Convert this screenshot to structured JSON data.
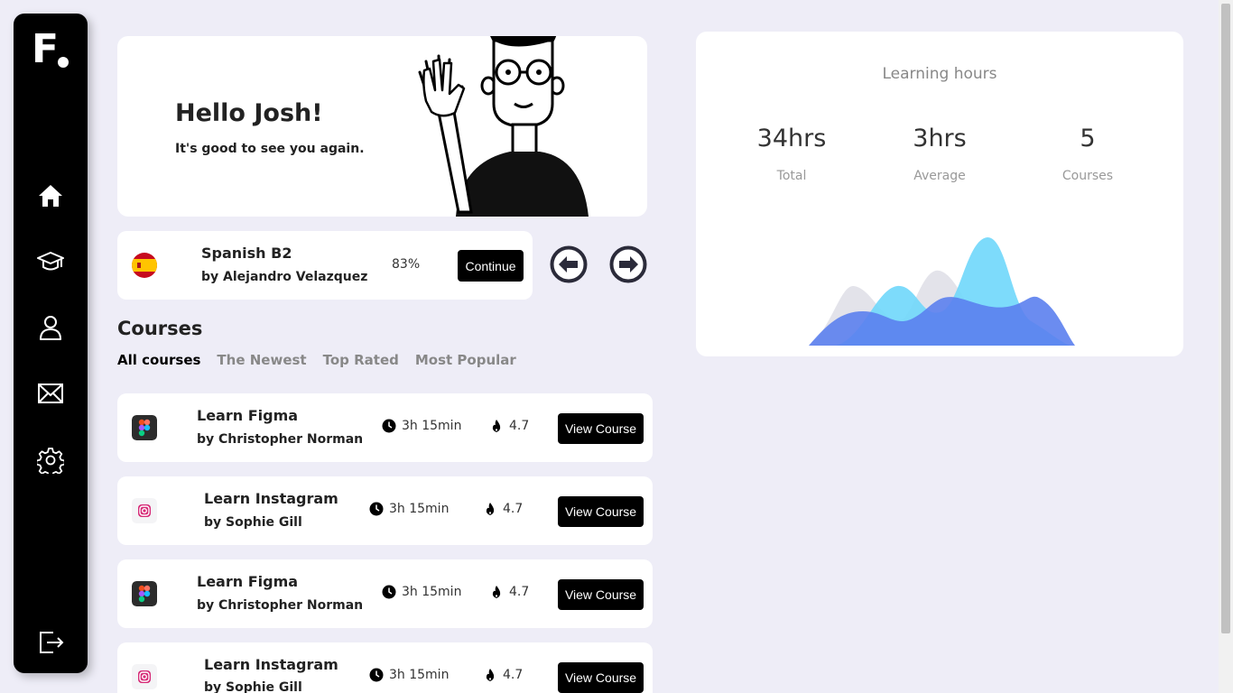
{
  "sidebar": {
    "logo": "F",
    "items": [
      {
        "icon": "home-icon"
      },
      {
        "icon": "graduation-cap-icon"
      },
      {
        "icon": "user-icon"
      },
      {
        "icon": "mail-icon"
      },
      {
        "icon": "gear-icon"
      },
      {
        "icon": "logout-icon"
      }
    ]
  },
  "hero": {
    "greeting": "Hello Josh!",
    "subtitle": "It's good to see you again."
  },
  "current_course": {
    "flag": "spain-flag-icon",
    "title": "Spanish B2",
    "author": "by Alejandro Velazquez",
    "progress": "83%",
    "continue_label": "Continue"
  },
  "courses": {
    "heading": "Courses",
    "tabs": [
      "All courses",
      "The Newest",
      "Top Rated",
      "Most Popular"
    ],
    "active_tab": "All courses",
    "list": [
      {
        "icon": "figma-icon",
        "title": "Learn Figma",
        "author": "by Christopher Norman",
        "duration": "3h 15min",
        "rating": "4.7",
        "button": "View Course"
      },
      {
        "icon": "instagram-icon",
        "title": "Learn Instagram",
        "author": "by Sophie Gill",
        "duration": "3h 15min",
        "rating": "4.7",
        "button": "View Course"
      },
      {
        "icon": "figma-icon",
        "title": "Learn Figma",
        "author": "by Christopher Norman",
        "duration": "3h 15min",
        "rating": "4.7",
        "button": "View Course"
      },
      {
        "icon": "instagram-icon",
        "title": "Learn Instagram",
        "author": "by Sophie Gill",
        "duration": "3h 15min",
        "rating": "4.7",
        "button": "View Course"
      }
    ]
  },
  "learning_hours": {
    "title": "Learning hours",
    "stats": [
      {
        "value": "34hrs",
        "label": "Total"
      },
      {
        "value": "3hrs",
        "label": "Average"
      },
      {
        "value": "5",
        "label": "Courses"
      }
    ]
  },
  "colors": {
    "background": "#eeedf7",
    "sidebar": "#000000",
    "card": "#ffffff",
    "wave_gray": "#e3e3ea",
    "wave_cyan": "#6fd7fb",
    "wave_blue": "#5b7fee"
  }
}
